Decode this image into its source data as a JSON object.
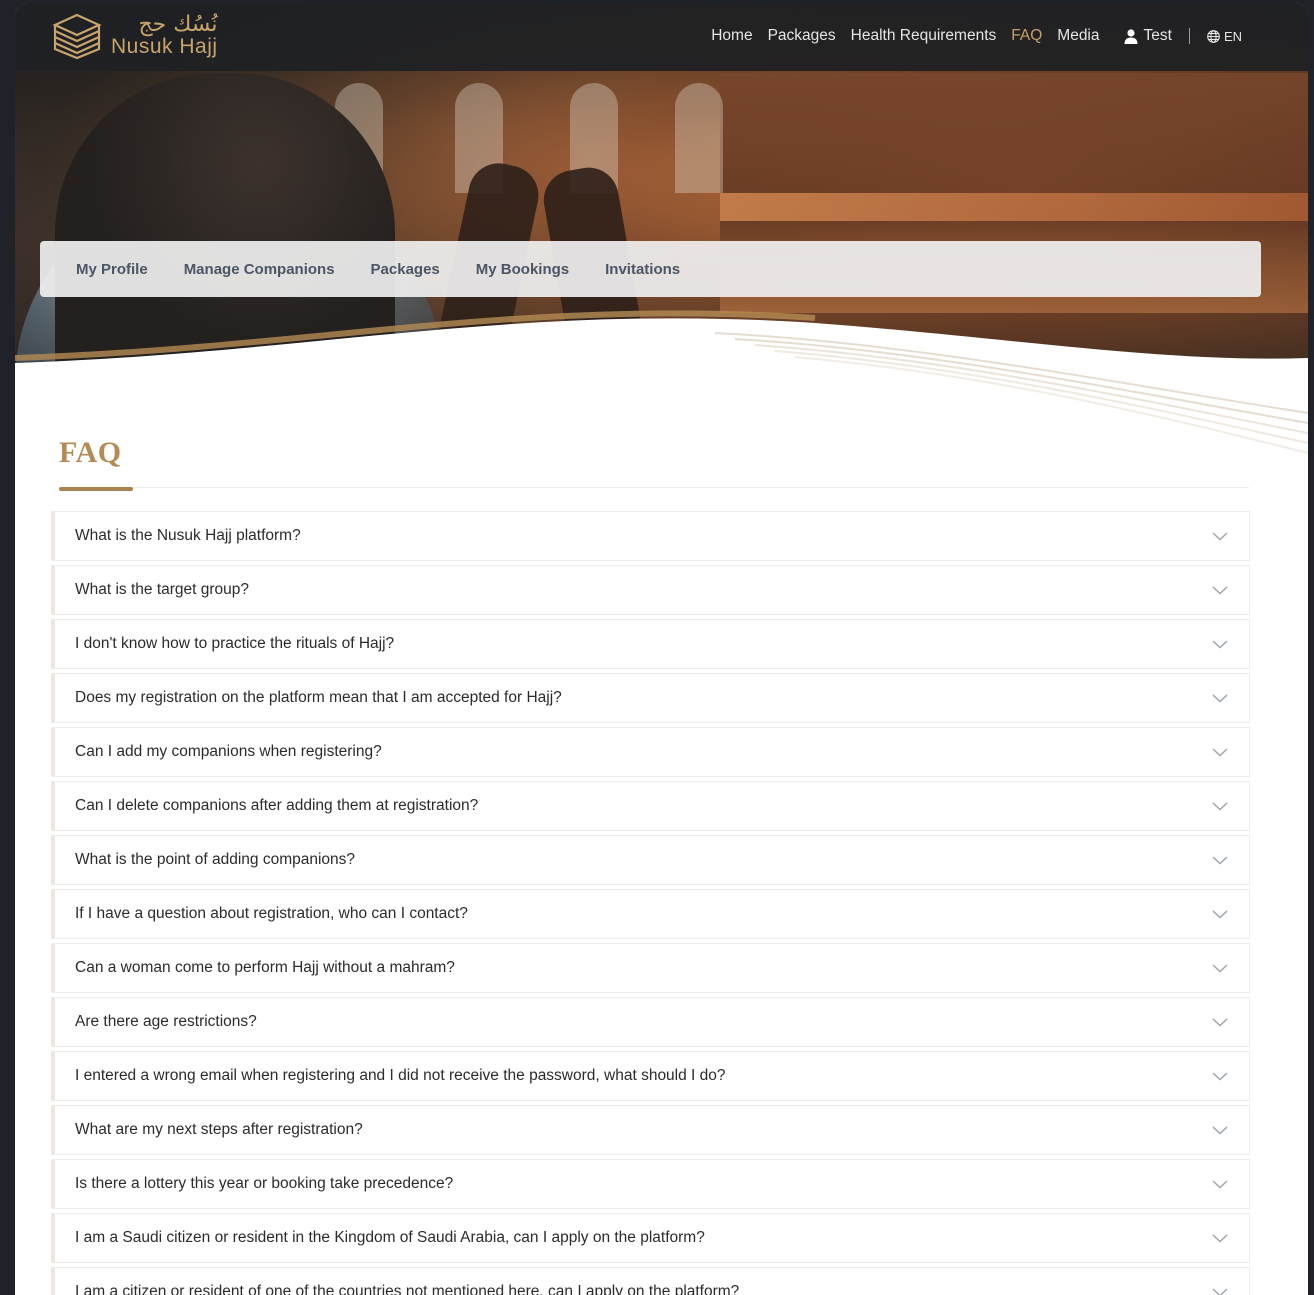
{
  "header": {
    "logo_ar": "نُسُك حج",
    "logo_en": "Nusuk Hajj",
    "nav": [
      {
        "label": "Home",
        "active": false
      },
      {
        "label": "Packages",
        "active": false
      },
      {
        "label": "Health Requirements",
        "active": false
      },
      {
        "label": "FAQ",
        "active": true
      },
      {
        "label": "Media",
        "active": false
      }
    ],
    "user_name": "Test",
    "language": "EN"
  },
  "subnav": {
    "tabs": [
      "My Profile",
      "Manage Companions",
      "Packages",
      "My Bookings",
      "Invitations"
    ]
  },
  "faq": {
    "title": "FAQ",
    "questions": [
      "What is the Nusuk Hajj platform?",
      "What is the target group?",
      "I don't know how to practice the rituals of Hajj?",
      "Does my registration on the platform mean that I am accepted for Hajj?",
      "Can I add my companions when registering?",
      "Can I delete companions after adding them at registration?",
      "What is the point of adding companions?",
      "If I have a question about registration, who can I contact?",
      "Can a woman come to perform Hajj without a mahram?",
      "Are there age restrictions?",
      "I entered a wrong email when registering and I did not receive the password, what should I do?",
      "What are my next steps after registration?",
      "Is there a lottery this year or booking take precedence?",
      "I am a Saudi citizen or resident in the Kingdom of Saudi Arabia, can I apply on the platform?",
      "I am a citizen or resident of one of the countries not mentioned here, can I apply on the platform?"
    ]
  },
  "colors": {
    "accent": "#c6a06a",
    "title": "#b48b54",
    "topbar": "#1e2024"
  }
}
